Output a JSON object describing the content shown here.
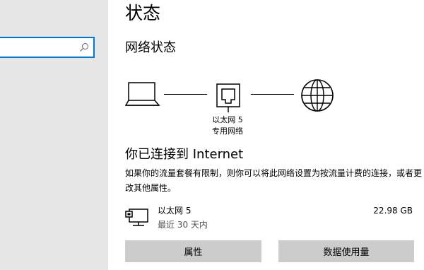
{
  "sidebar": {
    "search": {
      "value": "",
      "placeholder": "",
      "icon": "search-icon"
    }
  },
  "main": {
    "page_title": "状态",
    "section_title": "网络状态",
    "diagram": {
      "device_icon": "laptop-icon",
      "adapter_icon": "ethernet-port-icon",
      "internet_icon": "globe-icon",
      "adapter_label_line1": "以太网 5",
      "adapter_label_line2": "专用网络"
    },
    "connected_heading": "你已连接到 Internet",
    "description": "如果你的流量套餐有限制，则你可以将此网络设置为按流量计费的连接，或者更改其他属性。",
    "adapter": {
      "icon": "ethernet-adapter-icon",
      "name": "以太网 5",
      "period": "最近 30 天内",
      "usage": "22.98 GB"
    },
    "buttons": {
      "properties": "属性",
      "data_usage": "数据使用量"
    }
  },
  "colors": {
    "sidebar_bg": "#e6e6e6",
    "accent": "#0078d7",
    "button_bg": "#cccccc"
  }
}
